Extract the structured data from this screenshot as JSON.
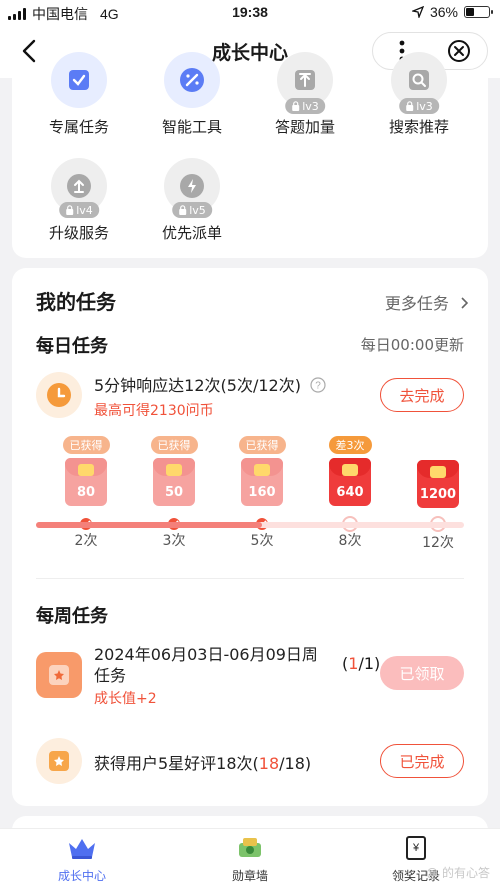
{
  "status": {
    "carrier": "中国电信",
    "network": "4G",
    "time": "19:38",
    "battery": "36%",
    "battery_level": 0.36
  },
  "nav": {
    "title": "成长中心"
  },
  "tools": [
    {
      "label": "专属任务",
      "icon": "task-icon",
      "locked": false,
      "level": ""
    },
    {
      "label": "智能工具",
      "icon": "magic-wand-icon",
      "locked": false,
      "level": ""
    },
    {
      "label": "答题加量",
      "icon": "upload-icon",
      "locked": true,
      "level": "lv3"
    },
    {
      "label": "搜索推荐",
      "icon": "search-icon",
      "locked": true,
      "level": "lv3"
    },
    {
      "label": "升级服务",
      "icon": "upgrade-icon",
      "locked": true,
      "level": "lv4"
    },
    {
      "label": "优先派单",
      "icon": "lightning-icon",
      "locked": true,
      "level": "lv5"
    }
  ],
  "my_tasks": {
    "title": "我的任务",
    "more": "更多任务"
  },
  "daily": {
    "title": "每日任务",
    "refresh": "每日00:00更新",
    "task_name": "5分钟响应达12次(5次/12次)",
    "reward": "最高可得2130问币",
    "button": "去完成",
    "progress": 5,
    "progress_max": 12,
    "milestones": [
      {
        "tag": "已获得",
        "value": "80",
        "label": "2次",
        "done": true
      },
      {
        "tag": "已获得",
        "value": "50",
        "label": "3次",
        "done": true
      },
      {
        "tag": "已获得",
        "value": "160",
        "label": "5次",
        "done": true
      },
      {
        "tag": "差3次",
        "value": "640",
        "label": "8次",
        "done": false
      },
      {
        "tag": "",
        "value": "1200",
        "label": "12次",
        "done": false
      }
    ]
  },
  "weekly": {
    "title": "每周任务",
    "task1_line1": "2024年06月03日-06月09日周",
    "task1_line2": "任务",
    "task1_count_done": "1",
    "task1_count_total": "/1)",
    "task1_count_open": "(",
    "task1_reward": "成长值+2",
    "task1_button": "已领取",
    "task2_name": "获得用户5星好评18次(",
    "task2_count_done": "18",
    "task2_count_total": "/18)",
    "task2_button": "已完成"
  },
  "tabs": [
    {
      "label": "成长中心",
      "icon": "crown-icon"
    },
    {
      "label": "勋章墙",
      "icon": "medal-icon"
    },
    {
      "label": "领奖记录",
      "icon": "receipt-icon"
    }
  ],
  "watermark": "@ 的有心答",
  "colors": {
    "accent": "#f0523a",
    "blue": "#4f6ff0"
  }
}
